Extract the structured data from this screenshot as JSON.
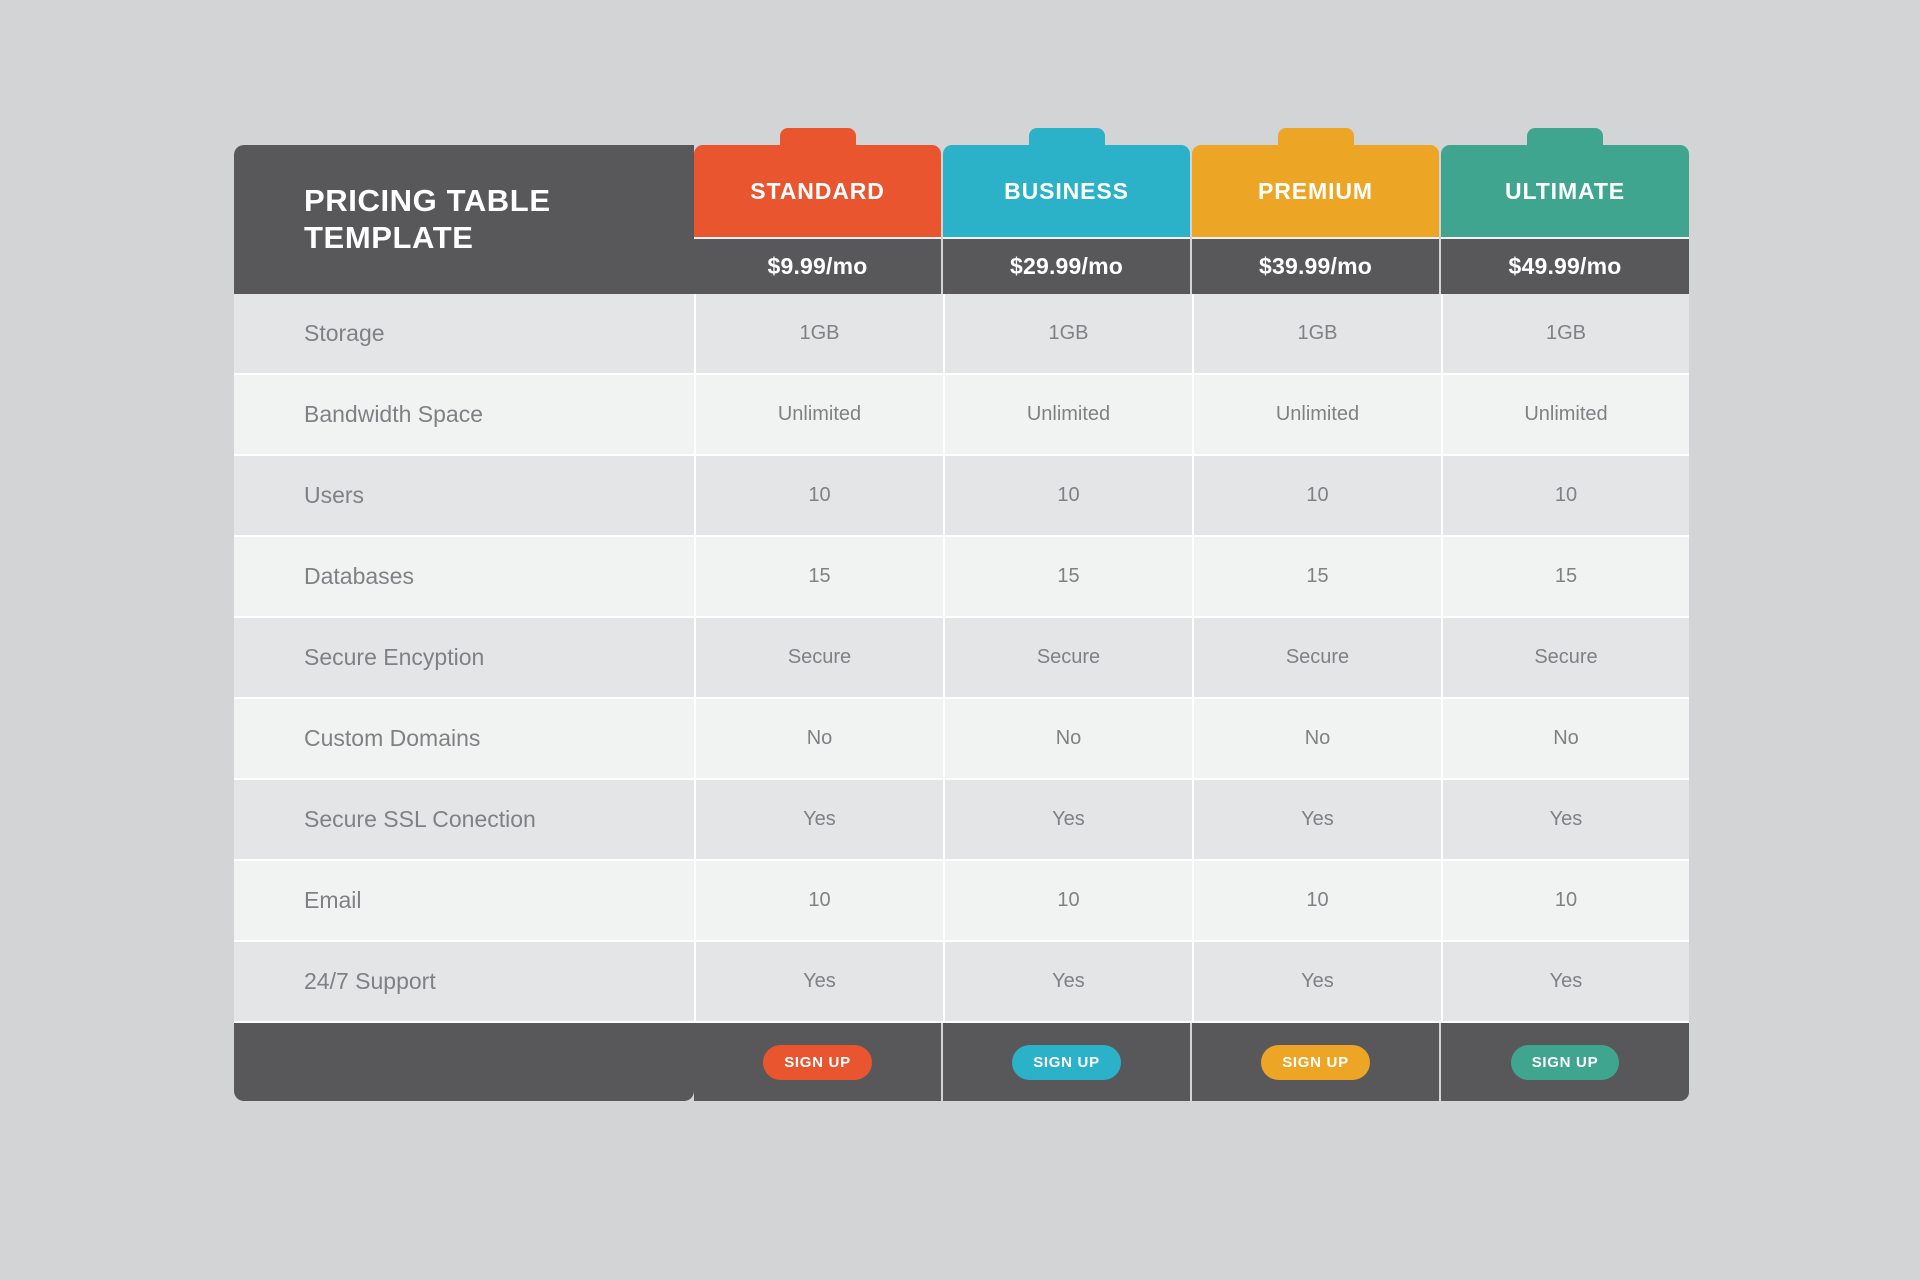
{
  "title": "PRICING TABLE TEMPLATE",
  "colors": {
    "page_background": "#d3d4d6",
    "dark": "#58585a",
    "row_dark": "#e3e5e7",
    "row_light": "#f1f2f2",
    "text_muted": "#808184"
  },
  "plans": [
    {
      "name": "STANDARD",
      "price": "$9.99/mo",
      "color": "#e8552f",
      "cta": "SIGN UP"
    },
    {
      "name": "BUSINESS",
      "price": "$29.99/mo",
      "color": "#2bb1c8",
      "cta": "SIGN UP"
    },
    {
      "name": "PREMIUM",
      "price": "$39.99/mo",
      "color": "#eda526",
      "cta": "SIGN UP"
    },
    {
      "name": "ULTIMATE",
      "price": "$49.99/mo",
      "color": "#40a58f",
      "cta": "SIGN UP"
    }
  ],
  "features": [
    {
      "label": "Storage",
      "values": [
        "1GB",
        "1GB",
        "1GB",
        "1GB"
      ]
    },
    {
      "label": "Bandwidth Space",
      "values": [
        "Unlimited",
        "Unlimited",
        "Unlimited",
        "Unlimited"
      ]
    },
    {
      "label": "Users",
      "values": [
        "10",
        "10",
        "10",
        "10"
      ]
    },
    {
      "label": "Databases",
      "values": [
        "15",
        "15",
        "15",
        "15"
      ]
    },
    {
      "label": "Secure Encyption",
      "values": [
        "Secure",
        "Secure",
        "Secure",
        "Secure"
      ]
    },
    {
      "label": "Custom Domains",
      "values": [
        "No",
        "No",
        "No",
        "No"
      ]
    },
    {
      "label": "Secure SSL Conection",
      "values": [
        "Yes",
        "Yes",
        "Yes",
        "Yes"
      ]
    },
    {
      "label": "Email",
      "values": [
        "10",
        "10",
        "10",
        "10"
      ]
    },
    {
      "label": "24/7 Support",
      "values": [
        "Yes",
        "Yes",
        "Yes",
        "Yes"
      ]
    }
  ]
}
